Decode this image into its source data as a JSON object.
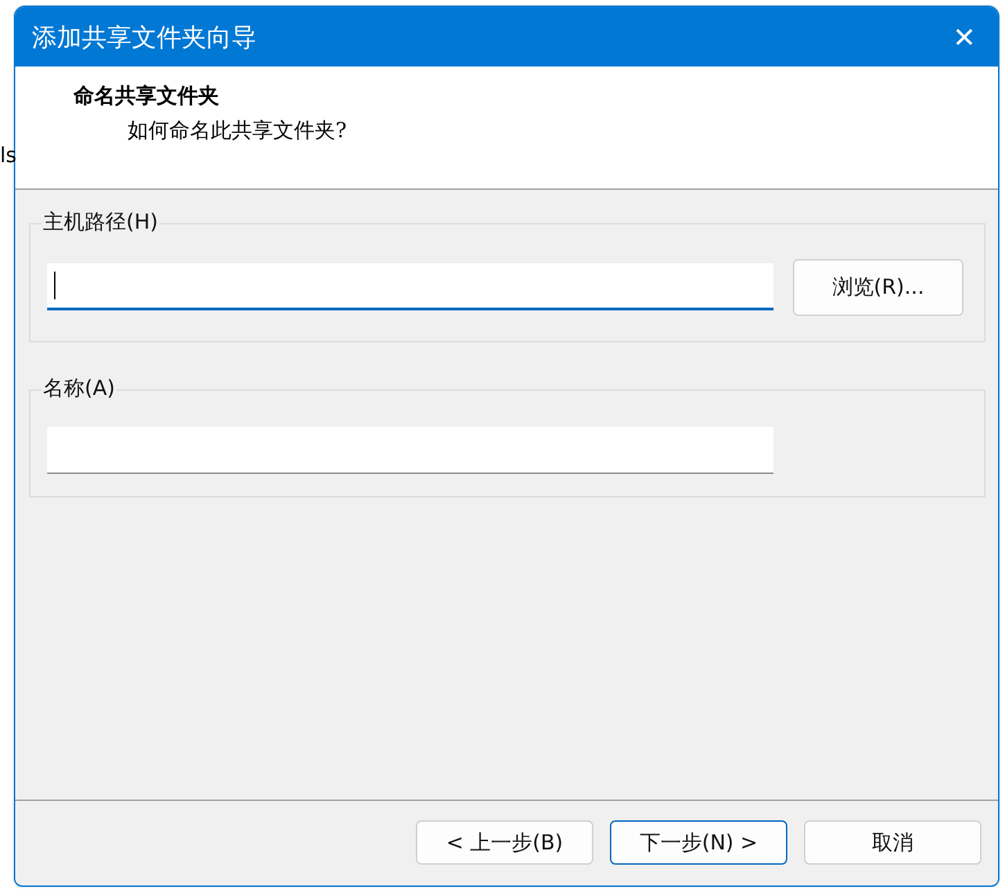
{
  "background": {
    "fragment": "ls"
  },
  "window": {
    "title": "添加共享文件夹向导",
    "close": "✕"
  },
  "header": {
    "title": "命名共享文件夹",
    "subtitle": "如何命名此共享文件夹?"
  },
  "groups": [
    {
      "label": "主机路径(H)",
      "field": {
        "focused": true
      },
      "button": "浏览(R)..."
    },
    {
      "label": "名称(A)",
      "field": {
        "focused": false
      }
    }
  ],
  "buttons": [
    {
      "label": "< 上一步(B)",
      "default": false
    },
    {
      "label": "下一步(N) >",
      "default": true
    },
    {
      "label": "取消",
      "default": false
    }
  ]
}
